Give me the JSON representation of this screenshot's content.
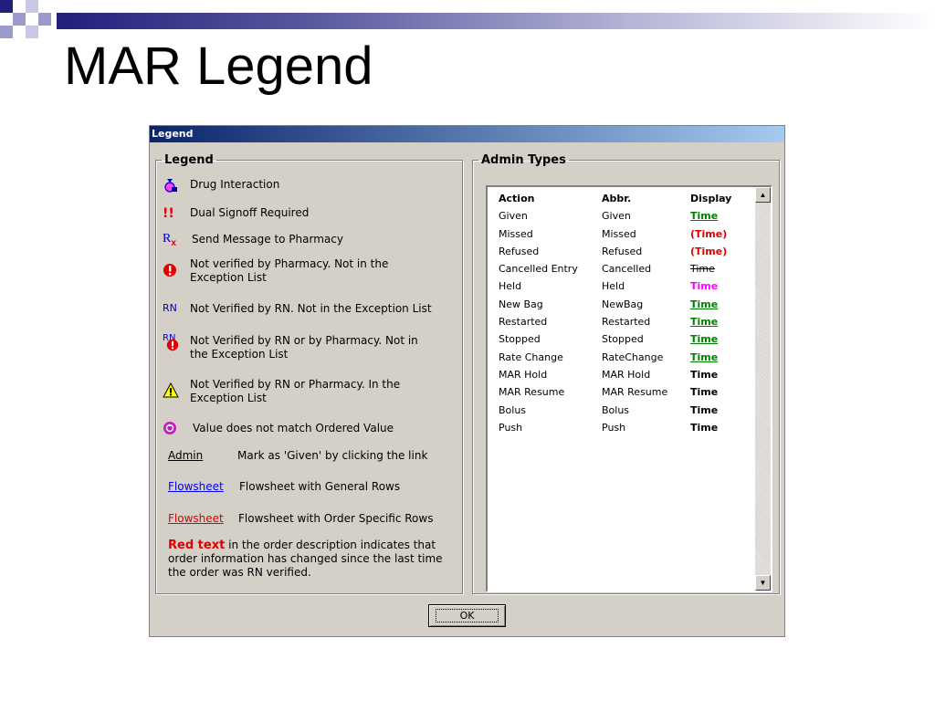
{
  "slide": {
    "title": "MAR Legend"
  },
  "dialog": {
    "title": "Legend",
    "legend_group": {
      "label": "Legend",
      "items": [
        {
          "icon": "drug-interaction-icon",
          "text": "Drug Interaction"
        },
        {
          "icon": "dual-signoff-icon",
          "glyph": "!!",
          "text": "Dual Signoff Required"
        },
        {
          "icon": "rx-icon",
          "glyph": "R",
          "glyph_sub": "x",
          "text": "Send Message to Pharmacy"
        },
        {
          "icon": "not-verified-pharmacy-icon",
          "text": "Not verified by Pharmacy. Not in the Exception List"
        },
        {
          "icon": "rn-icon",
          "glyph": "RN",
          "text": "Not Verified by RN. Not in the Exception List"
        },
        {
          "icon": "rn-pharmacy-icon",
          "glyph": "RN",
          "text": "Not Verified by RN or by Pharmacy.  Not in the Exception List"
        },
        {
          "icon": "warning-icon",
          "text": "Not Verified by RN or Pharmacy. In the Exception List"
        },
        {
          "icon": "value-mismatch-icon",
          "text": "Value does not match Ordered Value"
        }
      ],
      "links": [
        {
          "link": "Admin",
          "text": "Mark as 'Given' by clicking the link"
        },
        {
          "link": "Flowsheet",
          "text": "Flowsheet with General Rows"
        },
        {
          "link": "Flowsheet",
          "text": "Flowsheet with Order Specific Rows"
        }
      ],
      "note": {
        "red": "Red text",
        "rest": " in the order description indicates that order information has changed since the last time the order was RN verified."
      }
    },
    "admin_group": {
      "label": "Admin Types",
      "headers": [
        "Action",
        "Abbr.",
        "Display"
      ],
      "rows": [
        {
          "action": "Given",
          "abbr": "Given",
          "display": "Time",
          "style": "green"
        },
        {
          "action": "Missed",
          "abbr": "Missed",
          "display": "(Time)",
          "style": "red"
        },
        {
          "action": "Refused",
          "abbr": "Refused",
          "display": "(Time)",
          "style": "red"
        },
        {
          "action": "Cancelled Entry",
          "abbr": "Cancelled",
          "display": "Time",
          "style": "strike"
        },
        {
          "action": "Held",
          "abbr": "Held",
          "display": "Time",
          "style": "magenta"
        },
        {
          "action": "New Bag",
          "abbr": "NewBag",
          "display": "Time",
          "style": "green"
        },
        {
          "action": "Restarted",
          "abbr": "Restarted",
          "display": "Time",
          "style": "green"
        },
        {
          "action": "Stopped",
          "abbr": "Stopped",
          "display": "Time",
          "style": "green"
        },
        {
          "action": "Rate Change",
          "abbr": "RateChange",
          "display": "Time",
          "style": "green"
        },
        {
          "action": "MAR Hold",
          "abbr": "MAR Hold",
          "display": "Time",
          "style": "black"
        },
        {
          "action": "MAR Resume",
          "abbr": "MAR Resume",
          "display": "Time",
          "style": "black"
        },
        {
          "action": "Bolus",
          "abbr": "Bolus",
          "display": "Time",
          "style": "black"
        },
        {
          "action": "Push",
          "abbr": "Push",
          "display": "Time",
          "style": "black"
        }
      ]
    },
    "ok_label": "OK",
    "colors": {
      "dialog_bg": "#d4d0c8",
      "title_start": "#0a246a",
      "title_end": "#a6caf0",
      "green": "#008000",
      "red": "#e00000",
      "magenta": "#ff00ff",
      "link_blue": "#0000ff"
    }
  }
}
